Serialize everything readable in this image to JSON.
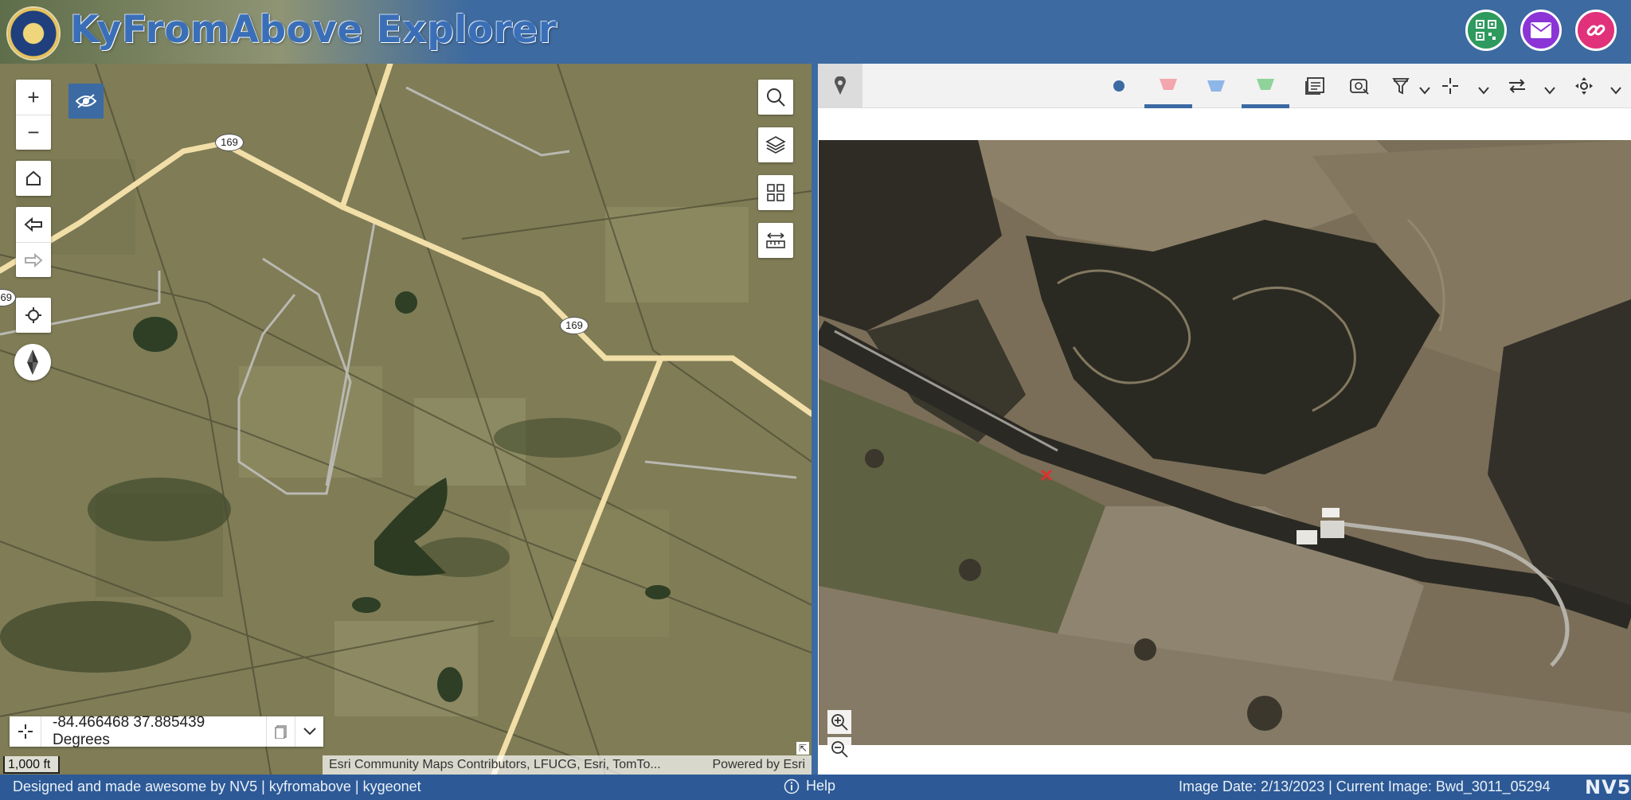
{
  "header": {
    "title": "KyFromAbove Explorer",
    "buttons": [
      {
        "name": "qr-code-button",
        "icon": "qr-code-icon",
        "color": "#2e9a5e"
      },
      {
        "name": "email-button",
        "icon": "email-icon",
        "color": "#8b35d6"
      },
      {
        "name": "share-link-button",
        "icon": "link-icon",
        "color": "#e0317a"
      }
    ]
  },
  "map": {
    "zoom_in": "+",
    "zoom_out": "−",
    "route_labels": [
      "169",
      "169",
      "69"
    ],
    "coordinates": "-84.466468 37.885439 Degrees",
    "scale": "1,000 ft",
    "attribution": "Esri Community Maps Contributors, LFUCG, Esri, TomTo...",
    "powered_by": "Powered by Esri"
  },
  "image_viewer": {
    "tools": [
      "pin-icon",
      "dot-icon",
      "pink-trapezoid-icon",
      "blue-trapezoid-icon",
      "green-trapezoid-icon",
      "image-list-icon",
      "image-filter-icon",
      "funnel-icon",
      "crosshair-icon",
      "swap-icon",
      "pan-icon"
    ],
    "colors": {
      "pink": "#f3a6ad",
      "blue": "#8eb6e8",
      "green": "#8fd39a",
      "dot": "#3c6aa3",
      "active": "#3c6aa3"
    }
  },
  "footer": {
    "credits": "Designed and made awesome by NV5 | kyfromabove | kygeonet",
    "help": "Help",
    "image_info": "Image Date: 2/13/2023 | Current Image: Bwd_3011_05294",
    "logo": "NV5"
  },
  "colors": {
    "header_bg": "#3d6aa0",
    "footer_bg": "#2d5a96",
    "road": "#f2dfa8"
  }
}
